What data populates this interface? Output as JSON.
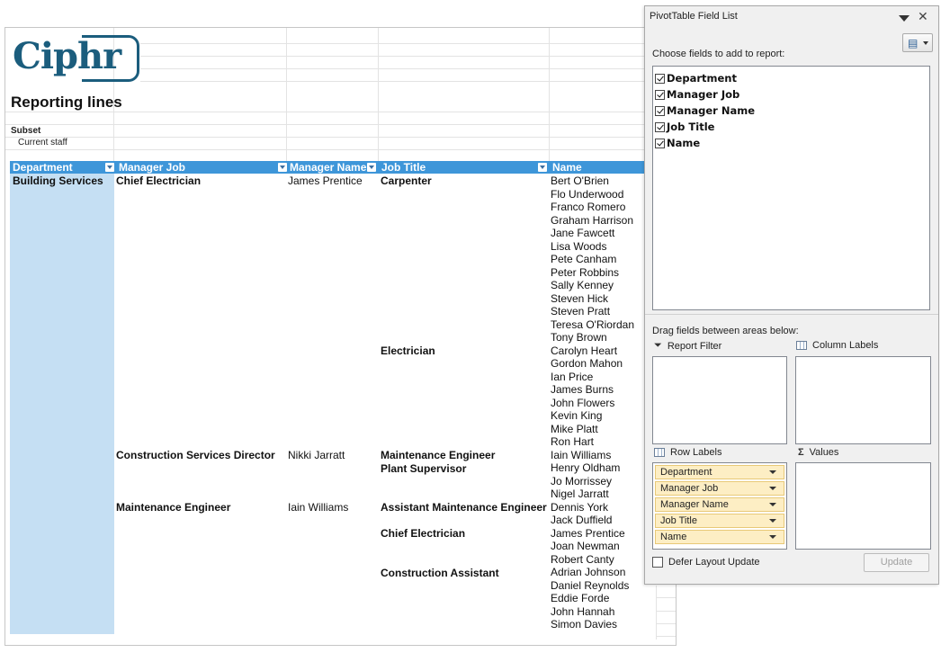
{
  "sheet": {
    "logo": "Ciphr",
    "title": "Reporting lines",
    "subset_label": "Subset",
    "subset_value": "Current staff",
    "headers": [
      "Department",
      "Manager Job",
      "Manager Name",
      "Job Title",
      "Name"
    ],
    "departments": [
      "Building Services"
    ],
    "manager_jobs": [
      "Chief Electrician",
      "Construction Services Director",
      "Maintenance Engineer"
    ],
    "manager_names": [
      "James Prentice",
      "Nikki Jarratt",
      "Iain Williams"
    ],
    "job_titles": [
      "Carpenter",
      "Electrician",
      "Maintenance Engineer",
      "Plant Supervisor",
      "Assistant Maintenance Engineer",
      "Chief Electrician",
      "Construction Assistant"
    ],
    "names": [
      "Bert O'Brien",
      "Flo Underwood",
      "Franco Romero",
      "Graham Harrison",
      "Jane Fawcett",
      "Lisa Woods",
      "Pete Canham",
      "Peter Robbins",
      "Sally Kenney",
      "Steven Hick",
      "Steven Pratt",
      "Teresa O'Riordan",
      "Tony Brown",
      "Carolyn Heart",
      "Gordon Mahon",
      "Ian Price",
      "James Burns",
      "John Flowers",
      "Kevin King",
      "Mike Platt",
      "Ron Hart",
      "Iain Williams",
      "Henry Oldham",
      "Jo Morrissey",
      "Nigel Jarratt",
      "Dennis York",
      "Jack Duffield",
      "James Prentice",
      "Joan Newman",
      "Robert Canty",
      "Adrian Johnson",
      "Daniel Reynolds",
      "Eddie Forde",
      "John Hannah",
      "Simon Davies"
    ]
  },
  "panel": {
    "title": "PivotTable Field List",
    "close_glyph": "✕",
    "layout_icon": "field-list-layout-icon",
    "choose_label": "Choose fields to add to report:",
    "fields": [
      {
        "label": "Department",
        "checked": true
      },
      {
        "label": "Manager Job",
        "checked": true
      },
      {
        "label": "Manager Name",
        "checked": true
      },
      {
        "label": "Job Title",
        "checked": true
      },
      {
        "label": "Name",
        "checked": true
      }
    ],
    "drag_label": "Drag fields between areas below:",
    "report_filter_label": "Report Filter",
    "column_labels_label": "Column Labels",
    "row_labels_label": "Row Labels",
    "values_label": "Values",
    "row_fields": [
      "Department",
      "Manager Job",
      "Manager Name",
      "Job Title",
      "Name"
    ],
    "defer_label": "Defer Layout Update",
    "update_label": "Update"
  }
}
